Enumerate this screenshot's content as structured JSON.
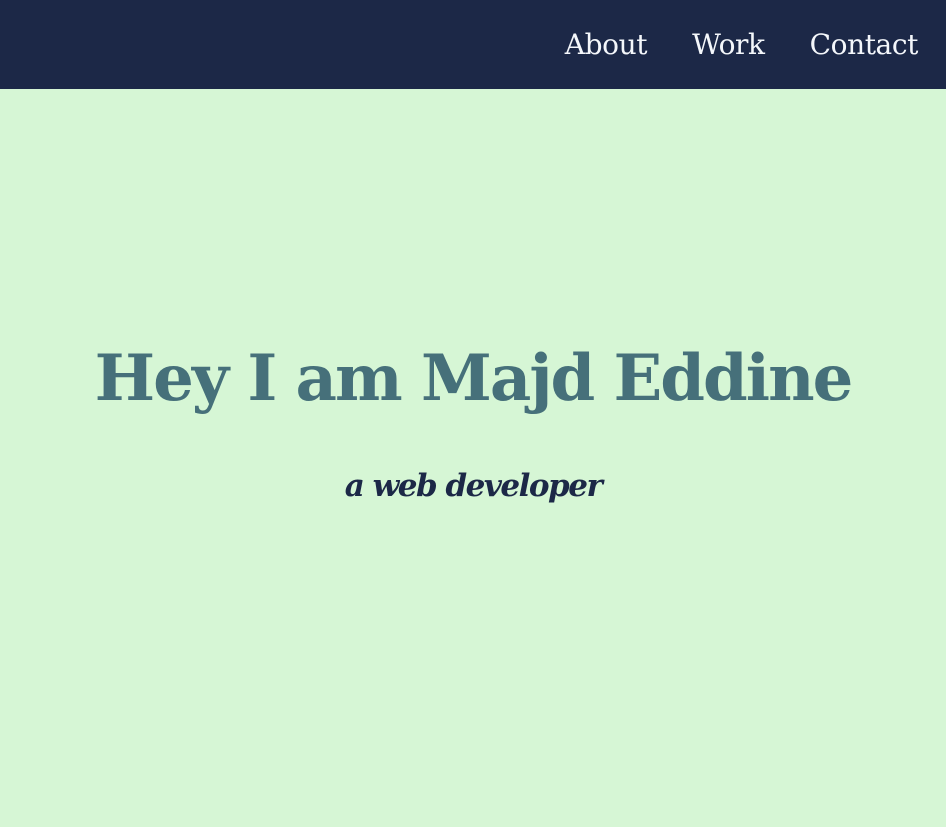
{
  "header": {
    "nav": [
      {
        "label": "About"
      },
      {
        "label": "Work"
      },
      {
        "label": "Contact"
      }
    ]
  },
  "hero": {
    "title": "Hey I am Majd Eddine",
    "subtitle": "a web developer"
  },
  "colors": {
    "header_background": "#1c2847",
    "page_background": "#d6f6d5",
    "title": "#46707a",
    "subtitle": "#1c2847",
    "nav_text": "#f4f7fb"
  }
}
